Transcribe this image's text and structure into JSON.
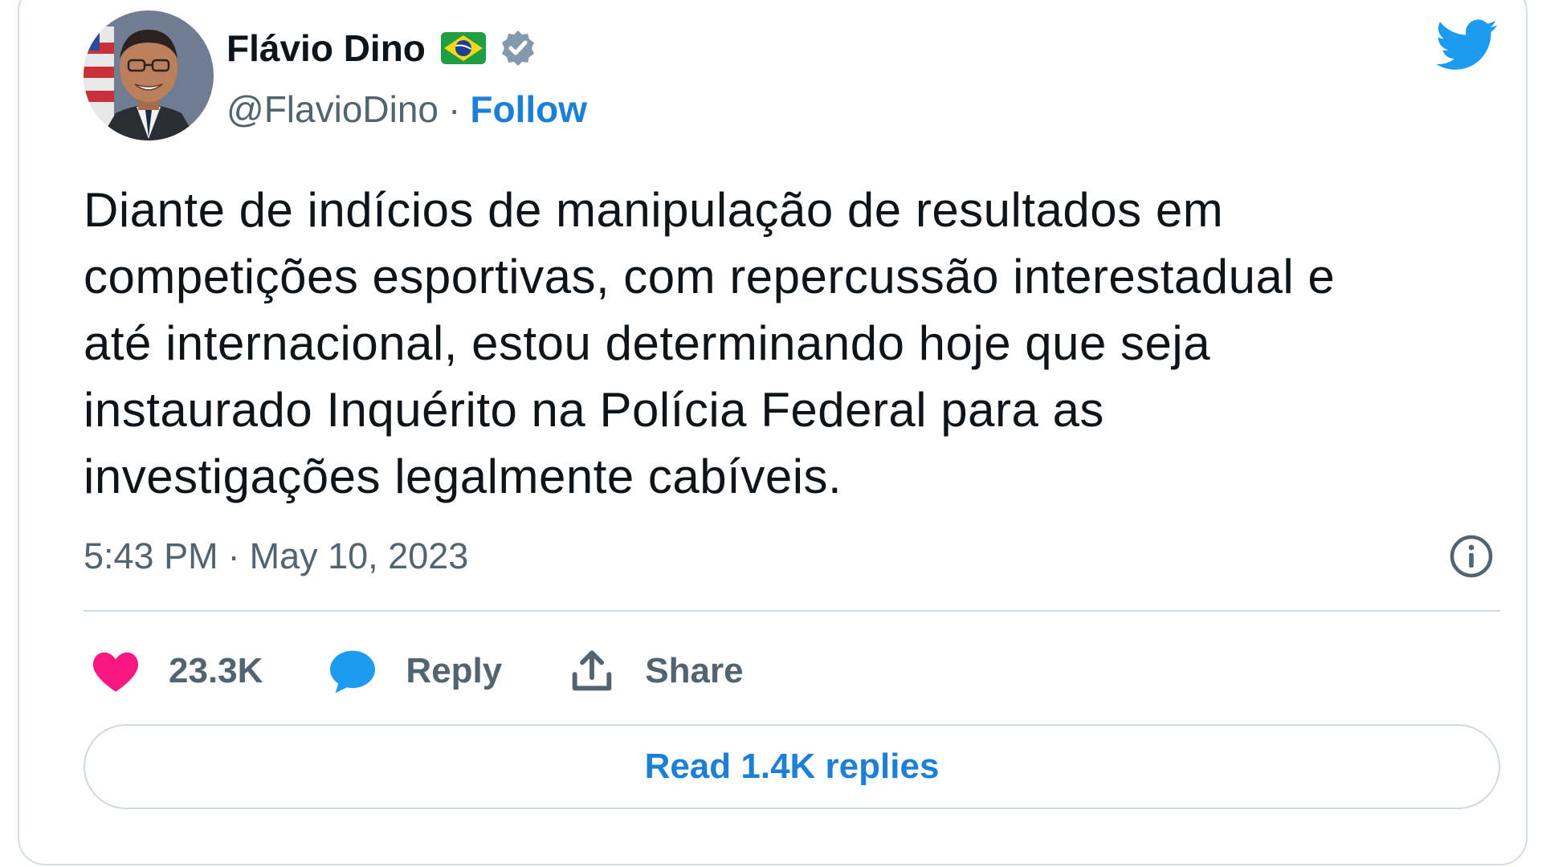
{
  "author": {
    "display_name": "Flávio Dino",
    "handle": "@FlavioDino",
    "separator": "·",
    "follow_label": "Follow"
  },
  "tweet": {
    "text": "Diante de indícios de manipulação de resultados em\ncompetições esportivas, com repercussão interestadual e\naté internacional, estou determinando hoje que seja\ninstaurado Inquérito na Polícia Federal para as\ninvestigações legalmente cabíveis.",
    "time": "5:43 PM",
    "separator": "·",
    "date": "May 10, 2023"
  },
  "actions": {
    "likes_count": "23.3K",
    "reply_label": "Reply",
    "share_label": "Share"
  },
  "replies_button": {
    "label": "Read 1.4K replies"
  },
  "icons": {
    "flag": "brazil-flag-icon",
    "verified": "verified-badge-icon",
    "brand": "twitter-bird-icon",
    "info": "info-icon",
    "like": "heart-icon",
    "reply": "speech-bubble-icon",
    "share": "share-upload-icon"
  },
  "colors": {
    "accent_blue": "#1d7fd6",
    "twitter_blue": "#1d9bf0",
    "heart_pink": "#f91880",
    "text_primary": "#0f1419",
    "text_secondary": "#536471",
    "border": "#cfd9de"
  }
}
